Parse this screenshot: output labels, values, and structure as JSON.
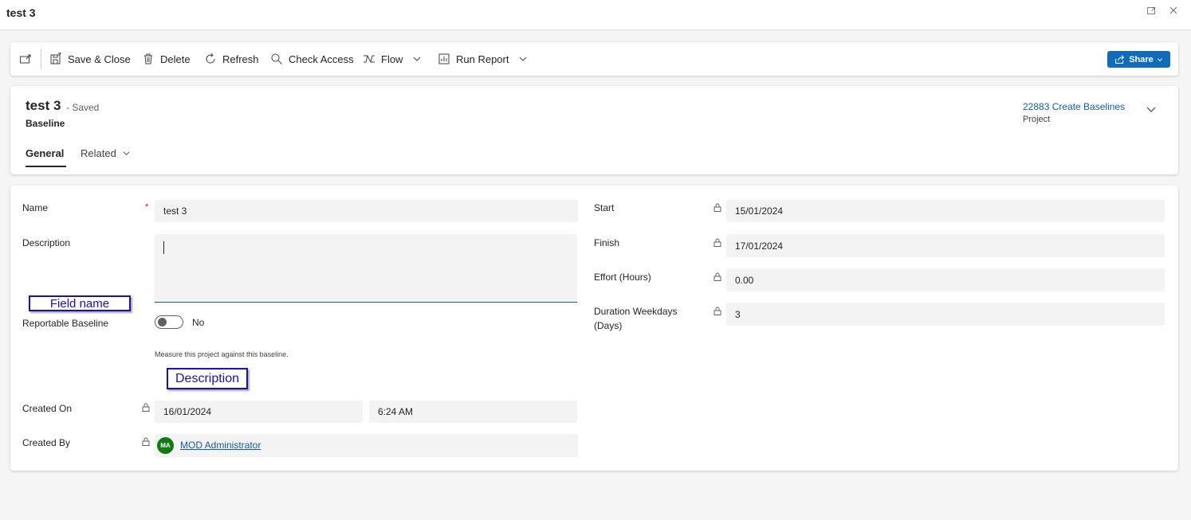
{
  "window": {
    "title": "test 3",
    "icons": [
      "expand-icon",
      "close-icon"
    ]
  },
  "commands": {
    "save_close": "Save & Close",
    "delete": "Delete",
    "refresh": "Refresh",
    "check_access": "Check Access",
    "flow": "Flow",
    "run_report": "Run Report",
    "share": "Share"
  },
  "header": {
    "title": "test 3",
    "status": "- Saved",
    "entity": "Baseline",
    "project_link": "22883 Create Baselines",
    "project_label": "Project",
    "tabs": [
      {
        "label": "General",
        "selected": true
      },
      {
        "label": "Related",
        "selected": false
      }
    ]
  },
  "form": {
    "left": {
      "name_label": "Name",
      "name_required_mark": "*",
      "name_value": "test 3",
      "description_label": "Description",
      "description_value": "",
      "reportable_label": "Reportable Baseline",
      "reportable_value": "No",
      "reportable_on": false,
      "reportable_help": "Measure this project against this baseline.",
      "created_on_label": "Created On",
      "created_on_date": "16/01/2024",
      "created_on_time": "6:24 AM",
      "created_by_label": "Created By",
      "created_by_initials": "MA",
      "created_by_name": "MOD Administrator"
    },
    "right": {
      "start_label": "Start",
      "start_value": "15/01/2024",
      "finish_label": "Finish",
      "finish_value": "17/01/2024",
      "effort_label": "Effort (Hours)",
      "effort_value": "0.00",
      "duration_label_line1": "Duration Weekdays",
      "duration_label_line2": "(Days)",
      "duration_value": "3"
    }
  },
  "annotations": {
    "field_name": "Field name",
    "description": "Description"
  },
  "colors": {
    "accent": "#0f6cbd",
    "link": "#115ea3",
    "avatar": "#107c10",
    "required": "#c50f1f",
    "annotation": "#1a0dc9"
  }
}
